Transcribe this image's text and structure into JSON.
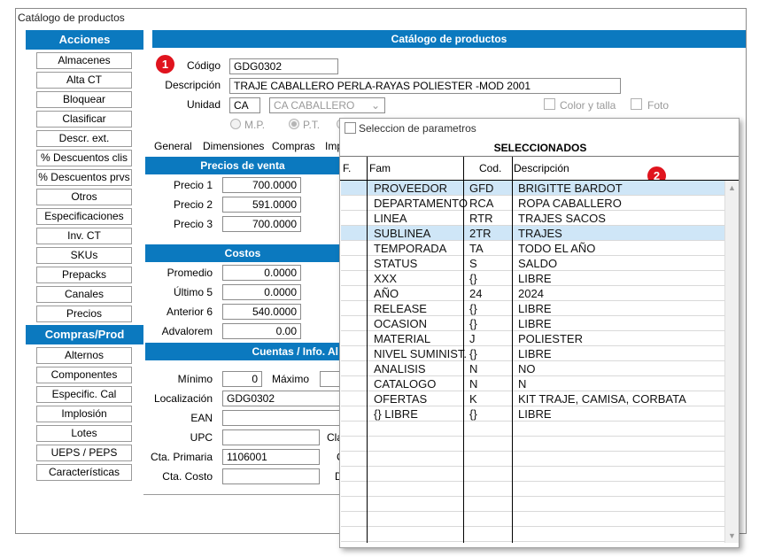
{
  "window": {
    "title": "Catálogo de productos"
  },
  "sidebar": {
    "acciones_header": "Acciones",
    "acciones": [
      "Almacenes",
      "Alta CT",
      "Bloquear",
      "Clasificar",
      "Descr. ext.",
      "% Descuentos clis",
      "% Descuentos prvs",
      "Otros",
      "Especificaciones",
      "Inv. CT",
      "SKUs",
      "Prepacks",
      "Canales",
      "Precios"
    ],
    "compras_header": "Compras/Prod",
    "compras": [
      "Alternos",
      "Componentes",
      "Especific. Cal",
      "Implosión",
      "Lotes",
      "UEPS / PEPS",
      "Características"
    ]
  },
  "main": {
    "header": "Catálogo de productos",
    "badge1": "1",
    "codigo_label": "Código",
    "codigo_value": "GDG0302",
    "descripcion_label": "Descripción",
    "descripcion_value": "TRAJE CABALLERO PERLA-RAYAS POLIESTER -MOD 2001",
    "unidad_label": "Unidad",
    "unidad_code": "CA",
    "unidad_select": "CA  CABALLERO",
    "color_talla_label": "Color y talla",
    "foto_label": "Foto",
    "radio_mp": "M.P.",
    "radio_pt": "P.T.",
    "tabs": [
      "General",
      "Dimensiones",
      "Compras",
      "Imp"
    ]
  },
  "precios": {
    "header": "Precios de venta",
    "rows": [
      {
        "label": "Precio 1",
        "value": "700.0000"
      },
      {
        "label": "Precio 2",
        "value": "591.0000"
      },
      {
        "label": "Precio 3",
        "value": "700.0000"
      }
    ]
  },
  "costos": {
    "header": "Costos",
    "rows": [
      {
        "label": "Promedio",
        "value": "0.0000"
      },
      {
        "label": "Último 5",
        "value": "0.0000"
      },
      {
        "label": "Anterior 6",
        "value": "540.0000"
      },
      {
        "label": "Advalorem",
        "value": "0.00"
      }
    ]
  },
  "cuentas": {
    "header": "Cuentas / Info. Al",
    "minimo_label": "Mínimo",
    "minimo_value": "0",
    "maximo_label": "Máximo",
    "localizacion_label": "Localización",
    "localizacion_value": "GDG0302",
    "ean_label": "EAN",
    "upc_label": "UPC",
    "cla_label": "Cla",
    "cta_primaria_label": "Cta. Primaria",
    "cta_primaria_value": "1106001",
    "c_label": "C",
    "cta_costo_label": "Cta. Costo",
    "d_label": "D"
  },
  "popup": {
    "checkbox_label": "Seleccion de parametros",
    "title": "SELECCIONADOS",
    "badge2": "2",
    "columns": {
      "f": "F.",
      "fam": "Fam",
      "cod": "Cod.",
      "desc": "Descripción"
    },
    "rows": [
      {
        "fam": "PROVEEDOR",
        "cod": "GFD",
        "desc": "BRIGITTE BARDOT",
        "selected": true
      },
      {
        "fam": "DEPARTAMENTO",
        "cod": "RCA",
        "desc": "ROPA CABALLERO",
        "selected": false
      },
      {
        "fam": "LINEA",
        "cod": "RTR",
        "desc": "TRAJES SACOS",
        "selected": false
      },
      {
        "fam": "SUBLINEA",
        "cod": "2TR",
        "desc": "TRAJES",
        "selected": true
      },
      {
        "fam": "TEMPORADA",
        "cod": "TA",
        "desc": "TODO EL AÑO",
        "selected": false
      },
      {
        "fam": "STATUS",
        "cod": "S",
        "desc": "SALDO",
        "selected": false
      },
      {
        "fam": "XXX",
        "cod": "{}",
        "desc": "LIBRE",
        "selected": false
      },
      {
        "fam": "AÑO",
        "cod": "24",
        "desc": "2024",
        "selected": false
      },
      {
        "fam": "RELEASE",
        "cod": "{}",
        "desc": "LIBRE",
        "selected": false
      },
      {
        "fam": "OCASION",
        "cod": "{}",
        "desc": "LIBRE",
        "selected": false
      },
      {
        "fam": "MATERIAL",
        "cod": "J",
        "desc": "POLIESTER",
        "selected": false
      },
      {
        "fam": "NIVEL SUMINIST.",
        "cod": "{}",
        "desc": "LIBRE",
        "selected": false
      },
      {
        "fam": "ANALISIS",
        "cod": "N",
        "desc": "NO",
        "selected": false
      },
      {
        "fam": "CATALOGO",
        "cod": "N",
        "desc": "N",
        "selected": false
      },
      {
        "fam": "OFERTAS",
        "cod": "K",
        "desc": "KIT TRAJE, CAMISA, CORBATA",
        "selected": false
      },
      {
        "fam": "{}  LIBRE",
        "cod": "{}",
        "desc": "LIBRE",
        "selected": false
      }
    ],
    "empty_rows": 8
  },
  "colors": {
    "accent": "#0b79bf",
    "badge": "#e0141e",
    "selected_row": "#cfe6f7"
  }
}
